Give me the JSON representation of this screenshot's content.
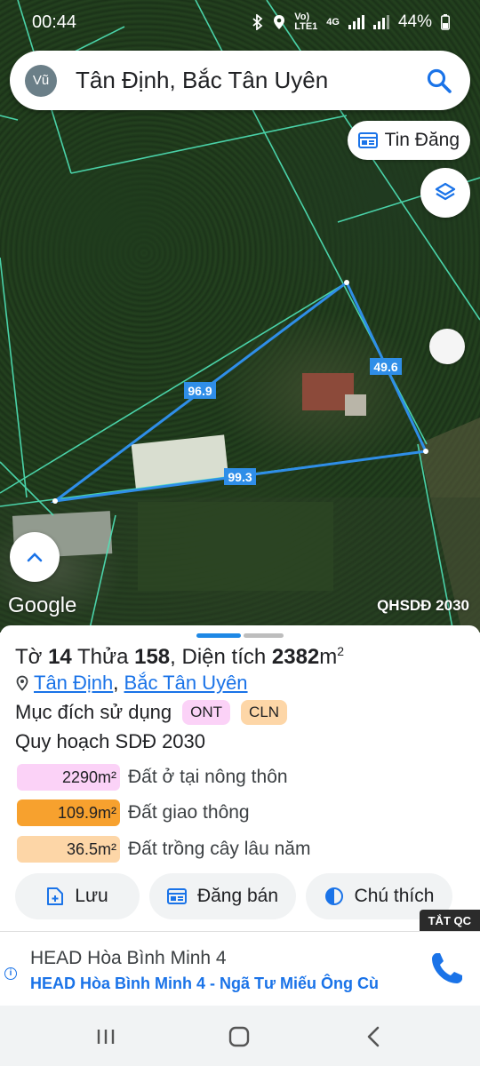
{
  "status_bar": {
    "time": "00:44",
    "volte_label": "Vo)\nLTE1",
    "network": "4G",
    "battery": "44%"
  },
  "search": {
    "avatar_initials": "Vũ",
    "query": "Tân Định, Bắc Tân Uyên"
  },
  "map": {
    "post_button_label": "Tin Đăng",
    "edge_lengths": [
      "96.9",
      "49.6",
      "99.3"
    ],
    "watermark": "Google",
    "layer_label": "QHSDĐ 2030"
  },
  "parcel": {
    "sheet_label": "Tờ",
    "sheet_no": "14",
    "lot_label": "Thửa",
    "lot_no": "158",
    "area_label": ", Diện tích",
    "area_value": "2382",
    "area_unit": "m",
    "area_unit_sup": "2",
    "location_ward": "Tân Định",
    "location_sep": ",",
    "location_district": "Bắc Tân Uyên",
    "purpose_label": "Mục đích sử dụng",
    "purpose_tags": [
      {
        "code": "ONT",
        "color": "#fbd2f7"
      },
      {
        "code": "CLN",
        "color": "#fdd6a7"
      }
    ],
    "plan_title": "Quy hoạch SDĐ 2030",
    "plan_items": [
      {
        "area": "2290m²",
        "label": "Đất ở tại nông thôn",
        "color": "#fbd2f7"
      },
      {
        "area": "109.9m²",
        "label": "Đất giao thông",
        "color": "#f7a12e"
      },
      {
        "area": "36.5m²",
        "label": "Đất trồng cây lâu năm",
        "color": "#fdd6a7"
      }
    ]
  },
  "actions": {
    "save_label": "Lưu",
    "post_sale_label": "Đăng bán",
    "legend_label": "Chú thích"
  },
  "ad": {
    "close_label": "TẮT QC",
    "title": "HEAD Hòa Bình Minh 4",
    "subtitle": "HEAD Hòa Bình Minh 4 - Ngã Tư Miếu Ông Cù"
  },
  "colors": {
    "accent": "#1a73e8",
    "parcel_line": "#2f8ee8",
    "boundary_line": "#4fe3b8"
  }
}
